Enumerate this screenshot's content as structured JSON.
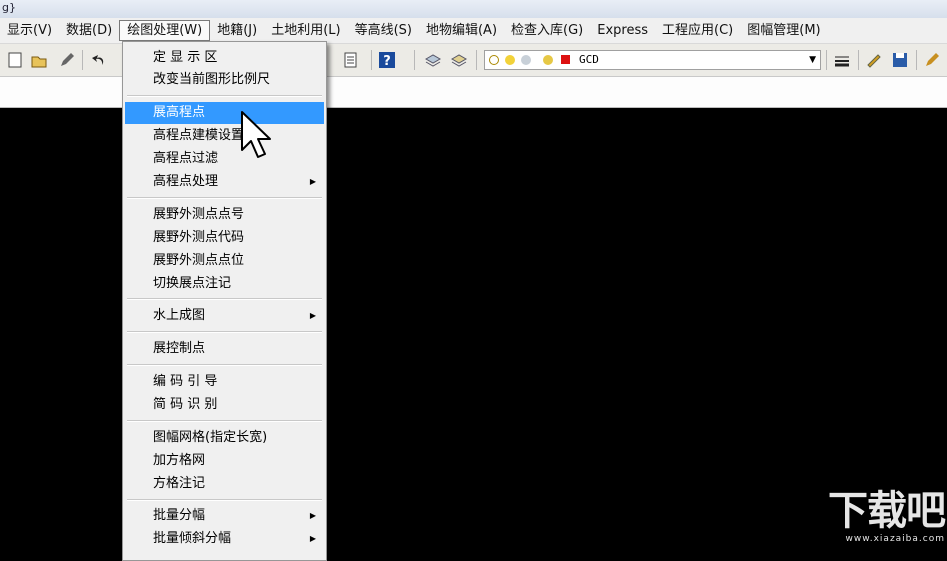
{
  "window": {
    "title_fragment": "g}"
  },
  "menubar": {
    "items": [
      {
        "label": "显示(V)",
        "active": false
      },
      {
        "label": "数据(D)",
        "active": false
      },
      {
        "label": "绘图处理(W)",
        "active": true
      },
      {
        "label": "地籍(J)",
        "active": false
      },
      {
        "label": "土地利用(L)",
        "active": false
      },
      {
        "label": "等高线(S)",
        "active": false
      },
      {
        "label": "地物编辑(A)",
        "active": false
      },
      {
        "label": "检查入库(G)",
        "active": false
      },
      {
        "label": "Express",
        "active": false
      },
      {
        "label": "工程应用(C)",
        "active": false
      },
      {
        "label": "图幅管理(M)",
        "active": false
      }
    ]
  },
  "toolbar": {
    "layer_name": "GCD",
    "icons": [
      "new-file-icon",
      "open-file-icon",
      "pencil-icon",
      "undo-icon",
      "print-preview-icon",
      "publish-icon",
      "help-icon",
      "layers-icon",
      "layer-states-icon",
      "lineweight-icon",
      "properties-icon",
      "save-icon",
      "edit-icon"
    ]
  },
  "dropdown": {
    "items": [
      {
        "label": "定 显 示 区",
        "submenu": false
      },
      {
        "label": "改变当前图形比例尺",
        "submenu": false
      },
      {
        "label": "展高程点",
        "submenu": false,
        "highlighted": true
      },
      {
        "label": "高程点建模设置",
        "submenu": false
      },
      {
        "label": "高程点过滤",
        "submenu": false
      },
      {
        "label": "高程点处理",
        "submenu": true
      },
      {
        "label": "展野外测点点号",
        "submenu": false
      },
      {
        "label": "展野外测点代码",
        "submenu": false
      },
      {
        "label": "展野外测点点位",
        "submenu": false
      },
      {
        "label": "切换展点注记",
        "submenu": false
      },
      {
        "label": "水上成图",
        "submenu": true
      },
      {
        "label": "展控制点",
        "submenu": false
      },
      {
        "label": "编 码 引 导",
        "submenu": false
      },
      {
        "label": "简 码 识 别",
        "submenu": false
      },
      {
        "label": "图幅网格(指定长宽)",
        "submenu": false
      },
      {
        "label": "加方格网",
        "submenu": false
      },
      {
        "label": "方格注记",
        "submenu": false
      },
      {
        "label": "批量分幅",
        "submenu": true
      },
      {
        "label": "批量倾斜分幅",
        "submenu": true
      }
    ]
  },
  "watermark": {
    "title": "下载吧",
    "url": "www.xiazaiba.com"
  },
  "colors": {
    "highlight": "#3399ff",
    "canvas": "#000000",
    "menu_bg": "#f0f0f0"
  }
}
